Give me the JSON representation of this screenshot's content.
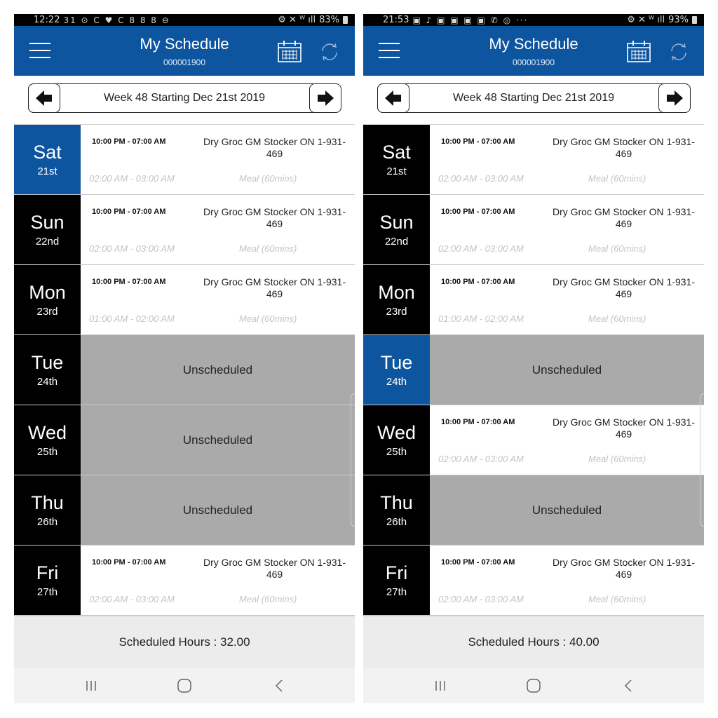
{
  "screens": [
    {
      "status": {
        "time": "12:22",
        "icons": "31 ⊙ C ♥ C 8 8 8 ⊖",
        "right_icons": "⚙ ✕ ᵂ ıll",
        "battery": "83%"
      },
      "header": {
        "title": "My Schedule",
        "subtitle": "000001900"
      },
      "week": {
        "label": "Week 48 Starting Dec 21st 2019"
      },
      "days": [
        {
          "name": "Sat",
          "date": "21st",
          "shift": "10:00 PM - 07:00 AM",
          "job": "Dry Groc GM Stocker ON 1-931-469",
          "meal_time": "02:00 AM - 03:00 AM",
          "meal_label": "Meal (60mins)"
        },
        {
          "name": "Sun",
          "date": "22nd",
          "shift": "10:00 PM - 07:00 AM",
          "job": "Dry Groc GM Stocker ON 1-931-469",
          "meal_time": "02:00 AM - 03:00 AM",
          "meal_label": "Meal (60mins)"
        },
        {
          "name": "Mon",
          "date": "23rd",
          "shift": "10:00 PM - 07:00 AM",
          "job": "Dry Groc GM Stocker ON 1-931-469",
          "meal_time": "01:00 AM - 02:00 AM",
          "meal_label": "Meal (60mins)"
        },
        {
          "name": "Tue",
          "date": "24th",
          "unscheduled": "Unscheduled"
        },
        {
          "name": "Wed",
          "date": "25th",
          "unscheduled": "Unscheduled"
        },
        {
          "name": "Thu",
          "date": "26th",
          "unscheduled": "Unscheduled"
        },
        {
          "name": "Fri",
          "date": "27th",
          "shift": "10:00 PM - 07:00 AM",
          "job": "Dry Groc GM Stocker ON 1-931-469",
          "meal_time": "02:00 AM - 03:00 AM",
          "meal_label": "Meal (60mins)"
        }
      ],
      "footer": {
        "hours": "Scheduled Hours : 32.00"
      }
    },
    {
      "status": {
        "time": "21:53",
        "icons": "▣ ♪ ▣ ▣ ▣ ▣ ✆ ◎ ···",
        "right_icons": "⚙ ✕ ᵂ ıll",
        "battery": "93%"
      },
      "header": {
        "title": "My Schedule",
        "subtitle": "000001900"
      },
      "week": {
        "label": "Week 48 Starting Dec 21st 2019"
      },
      "days": [
        {
          "name": "Sat",
          "date": "21st",
          "shift": "10:00 PM - 07:00 AM",
          "job": "Dry Groc GM Stocker ON 1-931-469",
          "meal_time": "02:00 AM - 03:00 AM",
          "meal_label": "Meal (60mins)"
        },
        {
          "name": "Sun",
          "date": "22nd",
          "shift": "10:00 PM - 07:00 AM",
          "job": "Dry Groc GM Stocker ON 1-931-469",
          "meal_time": "02:00 AM - 03:00 AM",
          "meal_label": "Meal (60mins)"
        },
        {
          "name": "Mon",
          "date": "23rd",
          "shift": "10:00 PM - 07:00 AM",
          "job": "Dry Groc GM Stocker ON 1-931-469",
          "meal_time": "01:00 AM - 02:00 AM",
          "meal_label": "Meal (60mins)"
        },
        {
          "name": "Tue",
          "date": "24th",
          "unscheduled": "Unscheduled"
        },
        {
          "name": "Wed",
          "date": "25th",
          "shift": "10:00 PM - 07:00 AM",
          "job": "Dry Groc GM Stocker ON 1-931-469",
          "meal_time": "02:00 AM - 03:00 AM",
          "meal_label": "Meal (60mins)"
        },
        {
          "name": "Thu",
          "date": "26th",
          "unscheduled": "Unscheduled"
        },
        {
          "name": "Fri",
          "date": "27th",
          "shift": "10:00 PM - 07:00 AM",
          "job": "Dry Groc GM Stocker ON 1-931-469",
          "meal_time": "02:00 AM - 03:00 AM",
          "meal_label": "Meal (60mins)"
        }
      ],
      "footer": {
        "hours": "Scheduled Hours : 40.00"
      }
    }
  ],
  "colors": {
    "brand_blue": "#0e55a0",
    "day_black": "#000000",
    "unscheduled_gray": "#aaaaaa",
    "footer_gray": "#ececec"
  },
  "icons": {
    "menu": "hamburger-icon",
    "calendar": "calendar-icon",
    "sync": "sync-icon",
    "prev": "arrow-left-icon",
    "next": "arrow-right-icon"
  }
}
